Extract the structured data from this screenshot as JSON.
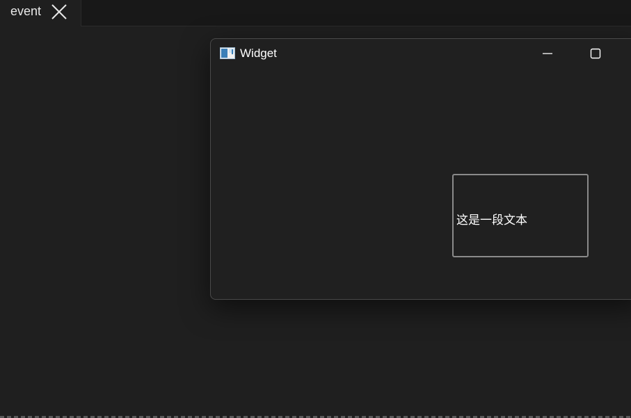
{
  "tab": {
    "label": "event",
    "close_icon": "close-icon"
  },
  "window": {
    "title": "Widget",
    "icon": "app-window-icon",
    "minimize_icon": "minimize-icon",
    "maximize_icon": "maximize-icon"
  },
  "content": {
    "text_box": "这是一段文本"
  }
}
